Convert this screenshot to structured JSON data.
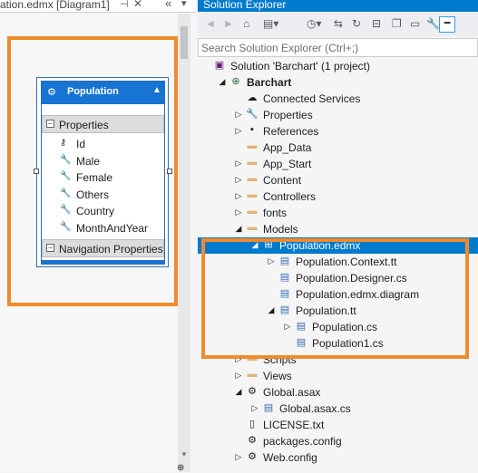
{
  "designer": {
    "tab_title": "ation.edmx [Diagram1]",
    "tab_pin": "⊣",
    "tab_close": "✕",
    "tab_chevrons": "«",
    "tab_menu": "▾",
    "zoom_glyph": "⊕",
    "entity": {
      "title": "Population",
      "properties_label": "Properties",
      "properties": [
        "Id",
        "Male",
        "Female",
        "Others",
        "Country",
        "MonthAndYear"
      ],
      "navigation_label": "Navigation Properties"
    }
  },
  "solution_explorer": {
    "title": "Solution Explorer",
    "search_placeholder": "Search Solution Explorer (Ctrl+;)",
    "tree": [
      {
        "label": "Solution 'Barchart' (1 project)",
        "icon": "solution-icon",
        "glyph": "▣",
        "level": 0,
        "arrow": ""
      },
      {
        "label": "Barchart",
        "icon": "web-project-icon",
        "glyph": "⊕",
        "level": 1,
        "arrow": "◢",
        "bold": true
      },
      {
        "label": "Connected Services",
        "icon": "connected-services-icon",
        "glyph": "☁",
        "level": 2,
        "arrow": ""
      },
      {
        "label": "Properties",
        "icon": "wrench-icon",
        "glyph": "🔧",
        "level": 2,
        "arrow": "▷"
      },
      {
        "label": "References",
        "icon": "references-icon",
        "glyph": "▪",
        "level": 2,
        "arrow": "▷"
      },
      {
        "label": "App_Data",
        "icon": "folder-icon",
        "glyph": "▬",
        "level": 2,
        "arrow": ""
      },
      {
        "label": "App_Start",
        "icon": "folder-icon",
        "glyph": "▬",
        "level": 2,
        "arrow": "▷"
      },
      {
        "label": "Content",
        "icon": "folder-icon",
        "glyph": "▬",
        "level": 2,
        "arrow": "▷"
      },
      {
        "label": "Controllers",
        "icon": "folder-icon",
        "glyph": "▬",
        "level": 2,
        "arrow": "▷"
      },
      {
        "label": "fonts",
        "icon": "folder-icon",
        "glyph": "▬",
        "level": 2,
        "arrow": "▷"
      },
      {
        "label": "Models",
        "icon": "folder-icon",
        "glyph": "▬",
        "level": 2,
        "arrow": "◢"
      },
      {
        "label": "Population.edmx",
        "icon": "edmx-icon",
        "glyph": "⊞",
        "level": 3,
        "arrow": "◢",
        "selected": true
      },
      {
        "label": "Population.Context.tt",
        "icon": "cs-file-icon",
        "glyph": "▤",
        "level": 4,
        "arrow": "▷"
      },
      {
        "label": "Population.Designer.cs",
        "icon": "cs-file-icon",
        "glyph": "▤",
        "level": 4,
        "arrow": ""
      },
      {
        "label": "Population.edmx.diagram",
        "icon": "cs-file-icon",
        "glyph": "▤",
        "level": 4,
        "arrow": ""
      },
      {
        "label": "Population.tt",
        "icon": "cs-file-icon",
        "glyph": "▤",
        "level": 4,
        "arrow": "◢"
      },
      {
        "label": "Population.cs",
        "icon": "cs-file-icon",
        "glyph": "▤",
        "level": 5,
        "arrow": "▷"
      },
      {
        "label": "Population1.cs",
        "icon": "cs-file-icon",
        "glyph": "▤",
        "level": 5,
        "arrow": ""
      },
      {
        "label": "Scripts",
        "icon": "folder-icon",
        "glyph": "▬",
        "level": 2,
        "arrow": "▷"
      },
      {
        "label": "Views",
        "icon": "folder-icon",
        "glyph": "▬",
        "level": 2,
        "arrow": "▷"
      },
      {
        "label": "Global.asax",
        "icon": "asax-icon",
        "glyph": "⚙",
        "level": 2,
        "arrow": "◢"
      },
      {
        "label": "Global.asax.cs",
        "icon": "cs-file-icon",
        "glyph": "▤",
        "level": 3,
        "arrow": "▷"
      },
      {
        "label": "LICENSE.txt",
        "icon": "text-file-icon",
        "glyph": "▯",
        "level": 2,
        "arrow": ""
      },
      {
        "label": "packages.config",
        "icon": "config-file-icon",
        "glyph": "⚙",
        "level": 2,
        "arrow": ""
      },
      {
        "label": "Web.config",
        "icon": "config-file-icon",
        "glyph": "⚙",
        "level": 2,
        "arrow": "▷"
      }
    ]
  },
  "colors": {
    "accent": "#007acc",
    "highlight_box": "#f08a2c",
    "entity_header": "#1874d2"
  }
}
